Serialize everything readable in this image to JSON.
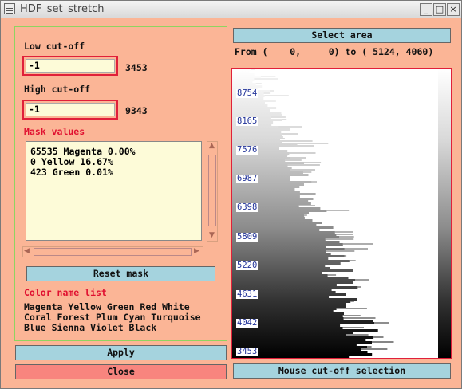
{
  "window": {
    "title": "HDF_set_stretch"
  },
  "low_cutoff": {
    "label": "Low cut-off",
    "value": "-1",
    "display": "3453"
  },
  "high_cutoff": {
    "label": "High cut-off",
    "value": "-1",
    "display": "9343"
  },
  "mask": {
    "label": "Mask values",
    "lines": [
      "65535 Magenta 0.00%",
      "0 Yellow 16.67%",
      "423 Green 0.01%"
    ],
    "reset_label": "Reset mask"
  },
  "color_names": {
    "label": "Color name list",
    "lines": [
      "Magenta Yellow Green Red White",
      "Coral Forest Plum Cyan Turquoise",
      "Blue Sienna Violet Black"
    ]
  },
  "buttons": {
    "apply": "Apply",
    "close": "Close",
    "select_area": "Select area",
    "mouse_cutoff": "Mouse cut-off selection"
  },
  "area": {
    "text": "From (    0,     0) to ( 5124, 4060)"
  },
  "histogram": {
    "ticks": [
      "8754",
      "8165",
      "7576",
      "6987",
      "6398",
      "5809",
      "5220",
      "4631",
      "4042",
      "3453"
    ]
  }
}
